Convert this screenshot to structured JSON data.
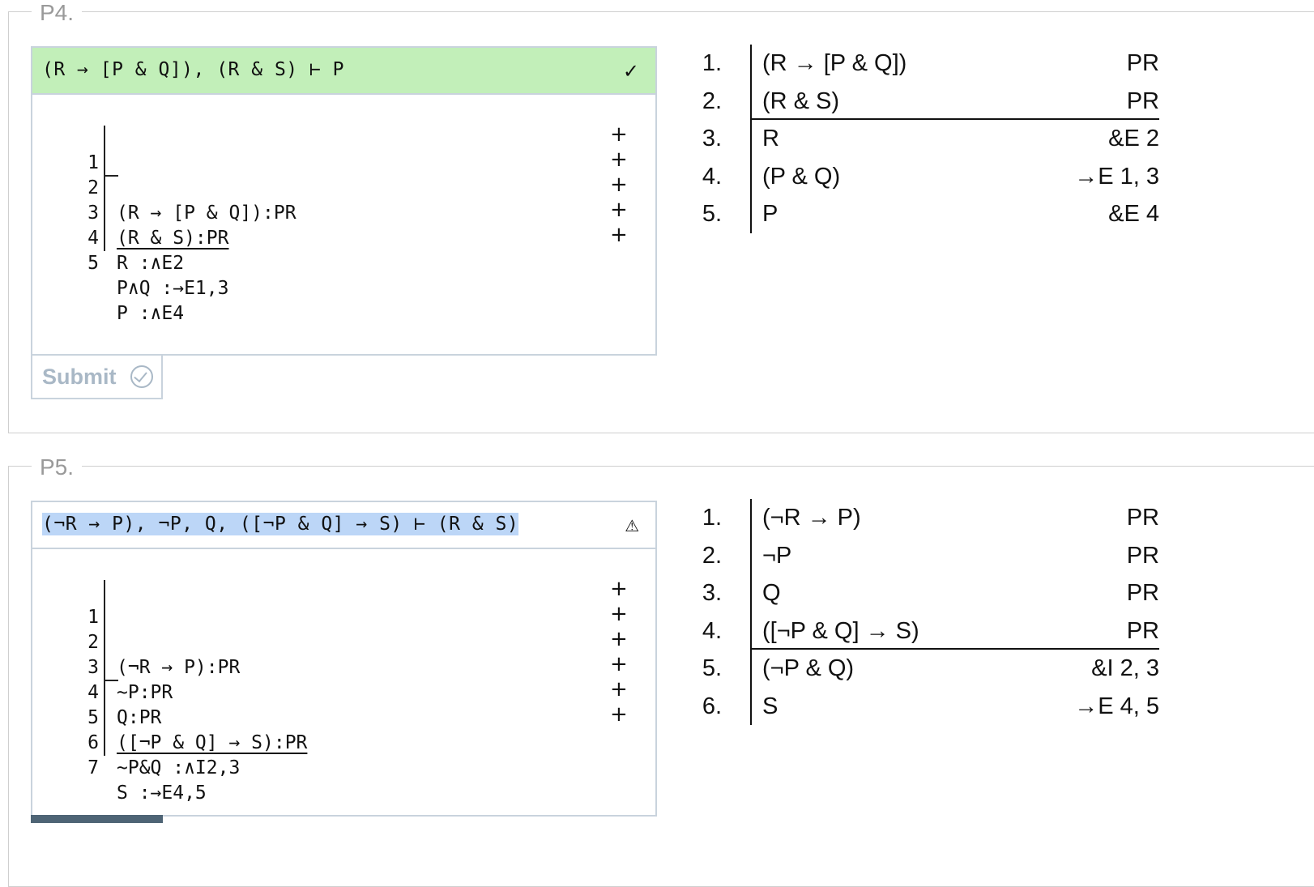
{
  "problems": [
    {
      "label": "P4.",
      "sequent": "(R → [P & Q]), (R & S) ⊢ P",
      "status_icon": "✓",
      "status": "correct",
      "lines": [
        {
          "num": "1",
          "text": "(R → [P & Q]):PR"
        },
        {
          "num": "2",
          "text": "(R & S):PR"
        },
        {
          "num": "3",
          "text": "R :∧E2"
        },
        {
          "num": "4",
          "text": "P∧Q :→E1,3"
        },
        {
          "num": "5",
          "text": "P :∧E4"
        }
      ],
      "plus_label": "+",
      "submit_label": "Submit",
      "proof": [
        {
          "num": "1.",
          "formula": "(R → [P & Q])",
          "rule": "PR"
        },
        {
          "num": "2.",
          "formula": "(R & S)",
          "rule": "PR"
        },
        {
          "num": "3.",
          "formula": "R",
          "rule": "&E 2"
        },
        {
          "num": "4.",
          "formula": "(P & Q)",
          "rule": "→E 1, 3"
        },
        {
          "num": "5.",
          "formula": "P",
          "rule": "&E 4"
        }
      ]
    },
    {
      "label": "P5.",
      "sequent": "(¬R → P), ¬P, Q, ([¬P & Q] → S) ⊢ (R & S)",
      "status_icon": "⚠",
      "status": "warning",
      "lines": [
        {
          "num": "1",
          "text": "(¬R → P):PR"
        },
        {
          "num": "2",
          "text": "~P:PR"
        },
        {
          "num": "3",
          "text": "Q:PR"
        },
        {
          "num": "4",
          "text": "([¬P & Q] → S):PR"
        },
        {
          "num": "5",
          "text": "~P&Q :∧I2,3"
        },
        {
          "num": "6",
          "text": "S :→E4,5"
        },
        {
          "num": "7",
          "text": ""
        }
      ],
      "plus_label": "+",
      "proof": [
        {
          "num": "1.",
          "formula": "(¬R → P)",
          "rule": "PR"
        },
        {
          "num": "2.",
          "formula": "¬P",
          "rule": "PR"
        },
        {
          "num": "3.",
          "formula": "Q",
          "rule": "PR"
        },
        {
          "num": "4.",
          "formula": "([¬P & Q] → S)",
          "rule": "PR"
        },
        {
          "num": "5.",
          "formula": "(¬P & Q)",
          "rule": "&I 2, 3"
        },
        {
          "num": "6.",
          "formula": "S",
          "rule": "→E 4, 5"
        }
      ]
    }
  ],
  "colors": {
    "correct_header": "#c2efb9",
    "selection": "#bcd6f7",
    "border": "#c9d3dd",
    "submit_text": "#a9b8c6"
  }
}
